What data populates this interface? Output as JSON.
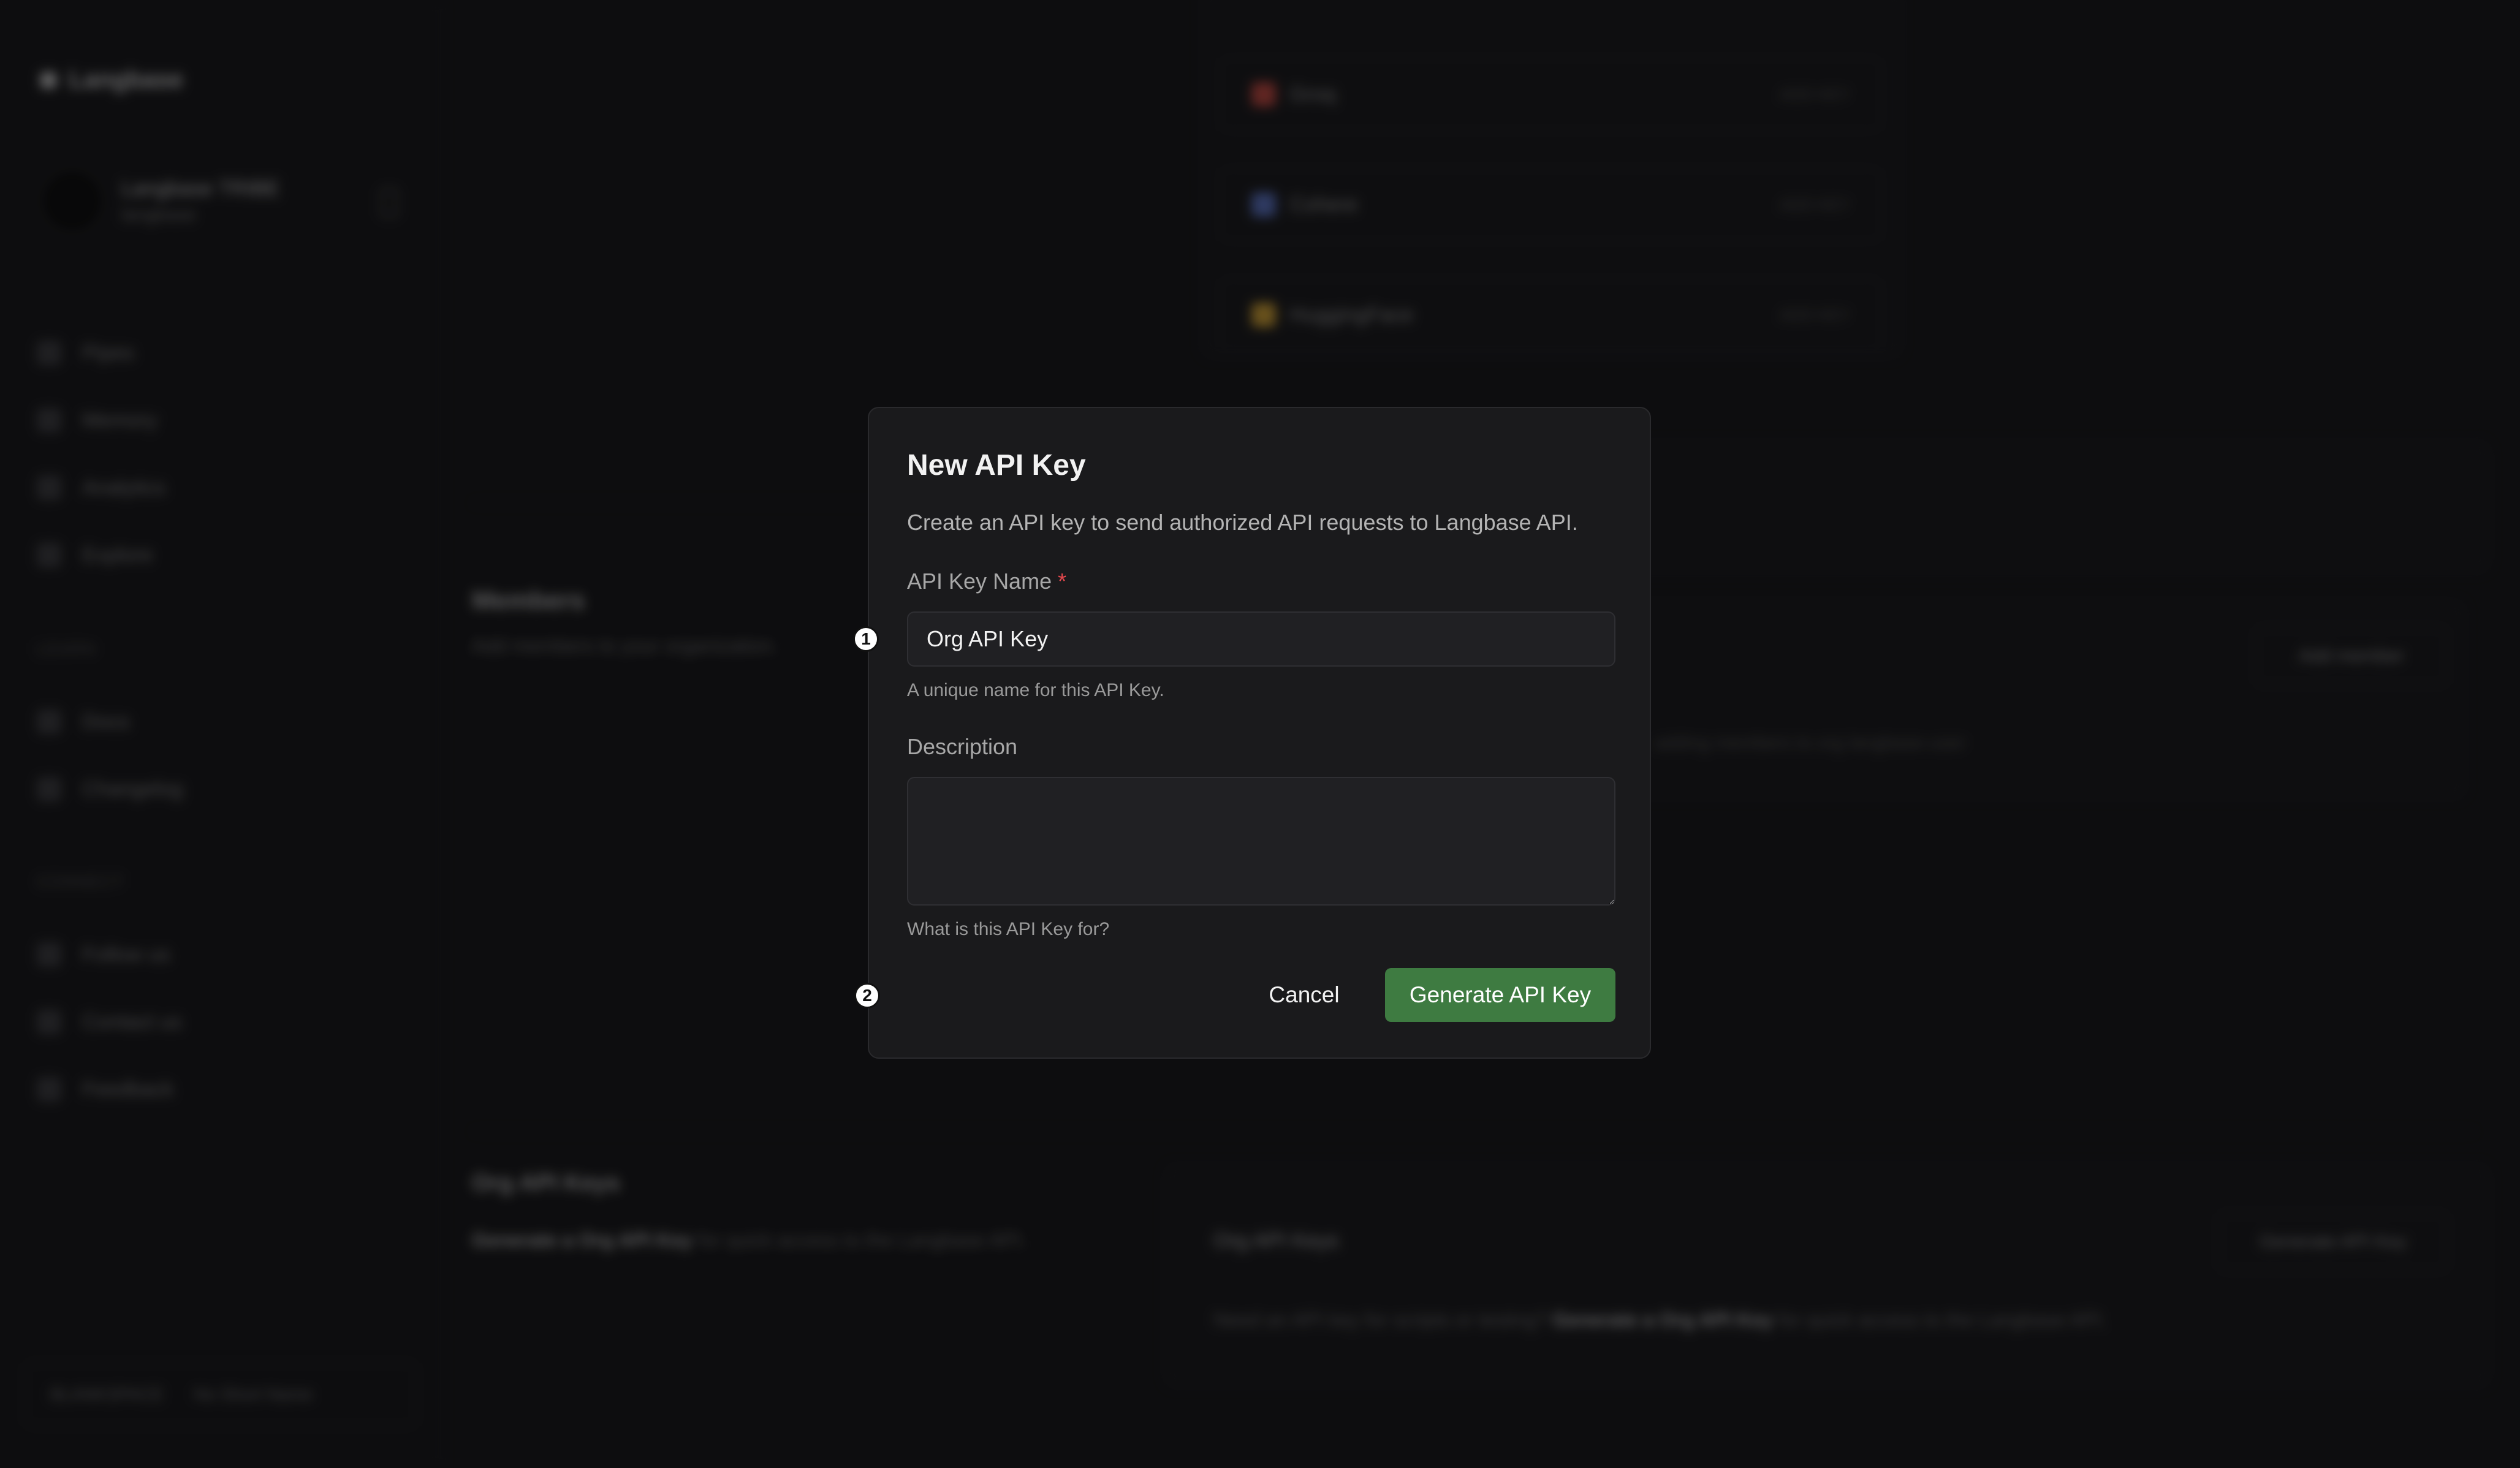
{
  "app": {
    "brand": "Langbase",
    "org_name": "Langbase TRIBE",
    "org_sub": "langbase"
  },
  "sidebar": {
    "items": [
      {
        "label": "Pipes",
        "icon": "pipes-icon"
      },
      {
        "label": "Memory",
        "icon": "memory-icon"
      },
      {
        "label": "Analytics",
        "icon": "analytics-icon"
      },
      {
        "label": "Explore",
        "icon": "explore-icon"
      }
    ],
    "section_learn": "LEARN",
    "learn_items": [
      {
        "label": "Docs",
        "icon": "docs-icon"
      },
      {
        "label": "Changelog",
        "icon": "changelog-icon"
      }
    ],
    "section_connect": "CONNECT",
    "connect_items": [
      {
        "label": "Follow us",
        "icon": "follow-icon"
      },
      {
        "label": "Contact us",
        "icon": "contact-icon"
      },
      {
        "label": "Feedback",
        "icon": "feedback-icon"
      }
    ],
    "footer": {
      "left": "BLANKSPACE",
      "right": "No Short Name"
    }
  },
  "background": {
    "providers": [
      {
        "name": "Groq",
        "action": "ADD KEY",
        "color": "#c9473e"
      },
      {
        "name": "Cohere",
        "action": "ADD KEY",
        "color": "#5a74c9"
      },
      {
        "name": "HuggingFace",
        "action": "ADD KEY",
        "color": "#d9a631"
      }
    ],
    "members": {
      "title": "Members",
      "subtitle": "Add members to your organization.",
      "button": "Add member",
      "row_text": "adding members to org langbase-user"
    },
    "org_keys": {
      "title": "Org API Keys",
      "subtitle_bold": "Generate a Org API Key",
      "subtitle_rest": " for quick access to the Langbase API.",
      "card_title": "Org API Keys",
      "card_button": "Generate API Key",
      "card_text_a": "Need an API key for scripts or testing? ",
      "card_text_bold": "Generate a Org API Key",
      "card_text_b": " for quick access to the Langbase API."
    }
  },
  "modal": {
    "title": "New API Key",
    "description": "Create an API key to send authorized API requests to Langbase API.",
    "name_label": "API Key Name",
    "required_mark": "*",
    "name_value": "Org API Key",
    "name_help": "A unique name for this API Key.",
    "desc_label": "Description",
    "desc_value": "",
    "desc_help": "What is this API Key for?",
    "cancel": "Cancel",
    "submit": "Generate API Key",
    "accent": "#3e7b41"
  },
  "markers": [
    "1",
    "2"
  ]
}
